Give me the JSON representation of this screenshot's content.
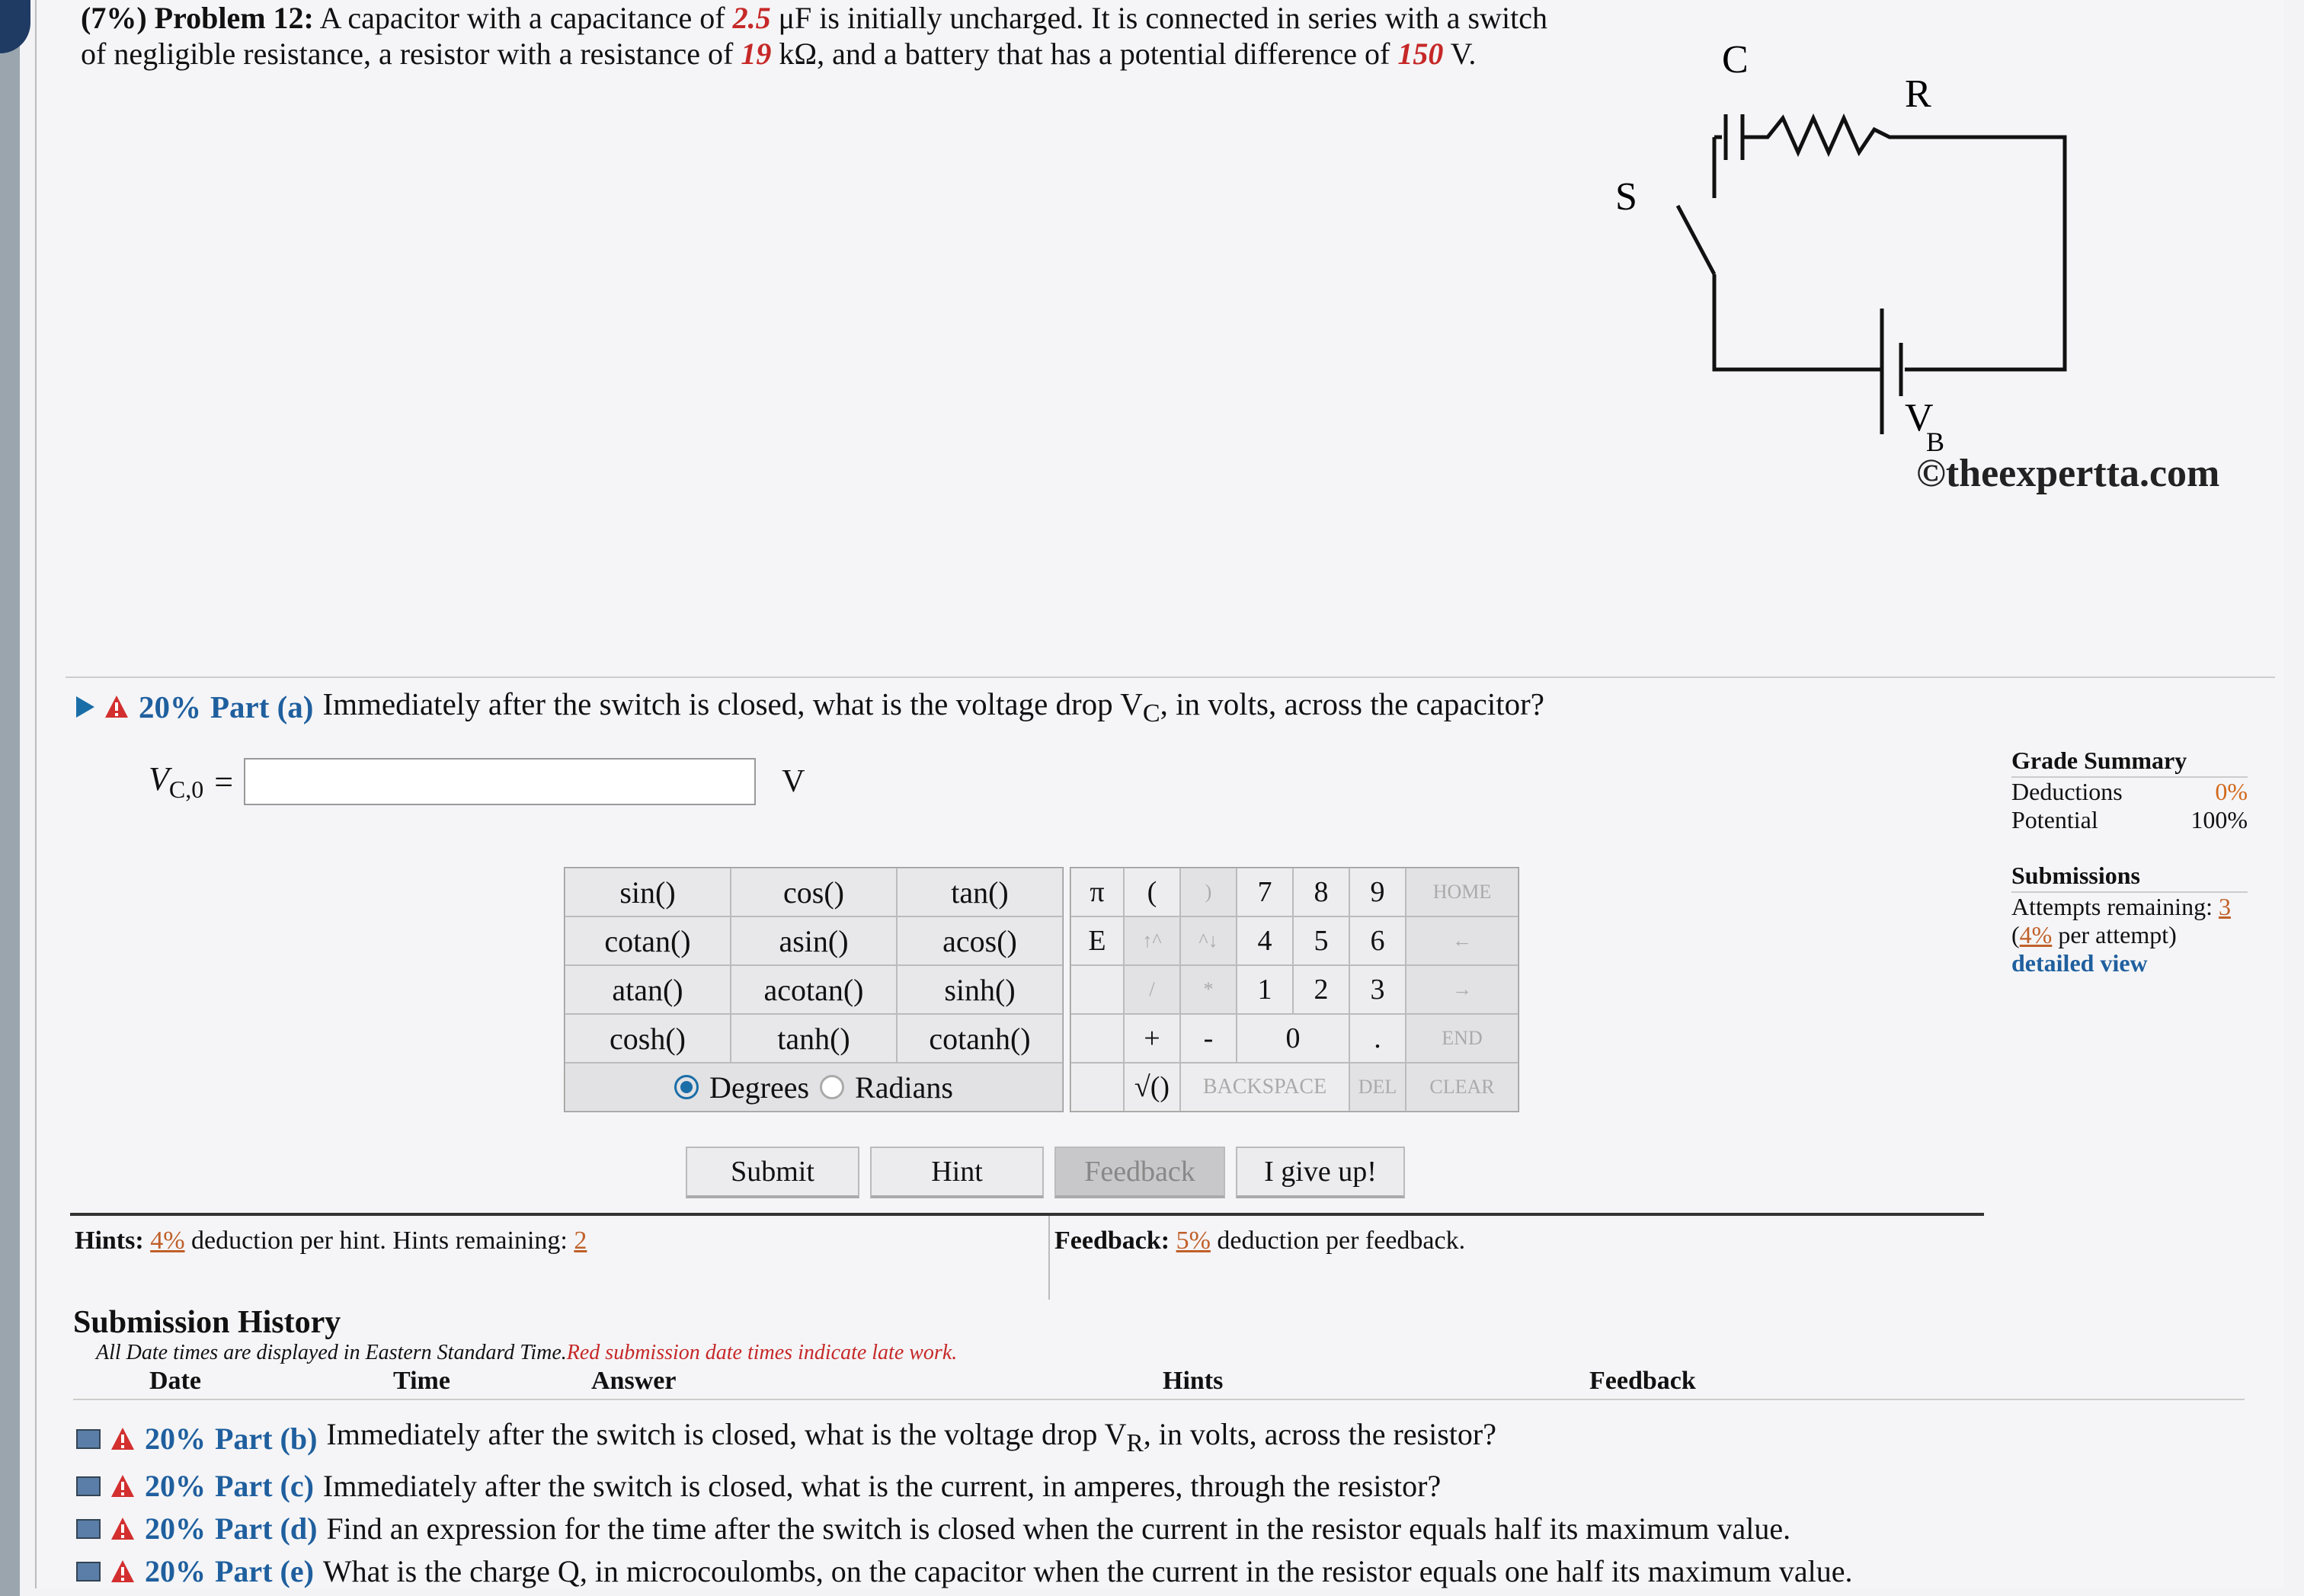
{
  "problem": {
    "label": "(7%) Problem 12:",
    "text_1": "A capacitor with a capacitance of ",
    "capacitance": "2.5",
    "text_2": " μF is initially uncharged. It is connected in series with a switch of negligible resistance, a resistor with a resistance of ",
    "resistance": "19",
    "text_3": " kΩ, and a battery that has a potential difference of ",
    "voltage": "150",
    "text_4": " V."
  },
  "circuit": {
    "label_c": "C",
    "label_r": "R",
    "label_s": "S",
    "label_vb": "V",
    "label_vb_sub": "B",
    "copyright": "©theexpertta.com"
  },
  "part_a": {
    "percent": "20%",
    "part": "Part (a)",
    "question": "Immediately after the switch is closed, what is the voltage drop V",
    "question_sub": "C",
    "question_end": ", in volts, across the capacitor?",
    "var_label": "V",
    "var_sub": "C,0",
    "equals": "=",
    "unit": "V"
  },
  "keypad": {
    "functions": [
      "sin()",
      "cos()",
      "tan()",
      "cotan()",
      "asin()",
      "acos()",
      "atan()",
      "acotan()",
      "sinh()",
      "cosh()",
      "tanh()",
      "cotanh()"
    ],
    "degrees": "Degrees",
    "radians": "Radians",
    "row1": [
      "π",
      "(",
      ")",
      "7",
      "8",
      "9",
      "HOME"
    ],
    "row2": [
      "E",
      "↑^",
      "^↓",
      "4",
      "5",
      "6",
      "←"
    ],
    "row3": [
      "",
      "/",
      "*",
      "1",
      "2",
      "3",
      "→"
    ],
    "row4": [
      "",
      "+",
      "-",
      "0",
      ".",
      "END"
    ],
    "row5": [
      "",
      "√()",
      "BACKSPACE",
      "DEL",
      "CLEAR"
    ]
  },
  "buttons": {
    "submit": "Submit",
    "hint": "Hint",
    "feedback": "Feedback",
    "give_up": "I give up!"
  },
  "grade": {
    "title": "Grade Summary",
    "deductions_label": "Deductions",
    "deductions_value": "0%",
    "potential_label": "Potential",
    "potential_value": "100%",
    "submissions_title": "Submissions",
    "attempts_label": "Attempts remaining:",
    "attempts_value": "3",
    "per_attempt_pre": "(",
    "per_attempt_pct": "4%",
    "per_attempt_post": " per attempt)",
    "detailed_view": "detailed view"
  },
  "hints": {
    "label": "Hints:",
    "pct": "4%",
    "text": " deduction per hint. Hints remaining: ",
    "remaining": "2"
  },
  "feedback": {
    "label": "Feedback:",
    "pct": "5%",
    "text": " deduction per feedback."
  },
  "history": {
    "title": "Submission History",
    "note": "All Date times are displayed in Eastern Standard Time.",
    "note_red": "Red submission date times indicate late work.",
    "cols": [
      "Date",
      "Time",
      "Answer",
      "Hints",
      "Feedback"
    ]
  },
  "other_parts": [
    {
      "percent": "20%",
      "part": "Part (b)",
      "q": "Immediately after the switch is closed, what is the voltage drop V",
      "sub": "R",
      "q_end": ", in volts, across the resistor?"
    },
    {
      "percent": "20%",
      "part": "Part (c)",
      "q": "Immediately after the switch is closed, what is the current, in amperes, through the resistor?",
      "sub": "",
      "q_end": ""
    },
    {
      "percent": "20%",
      "part": "Part (d)",
      "q": "Find an expression for the time after the switch is closed when the current in the resistor equals half its maximum value.",
      "sub": "",
      "q_end": ""
    },
    {
      "percent": "20%",
      "part": "Part (e)",
      "q": "What is the charge Q, in microcoulombs, on the capacitor when the current in the resistor equals one half its maximum value.",
      "sub": "",
      "q_end": ""
    }
  ]
}
